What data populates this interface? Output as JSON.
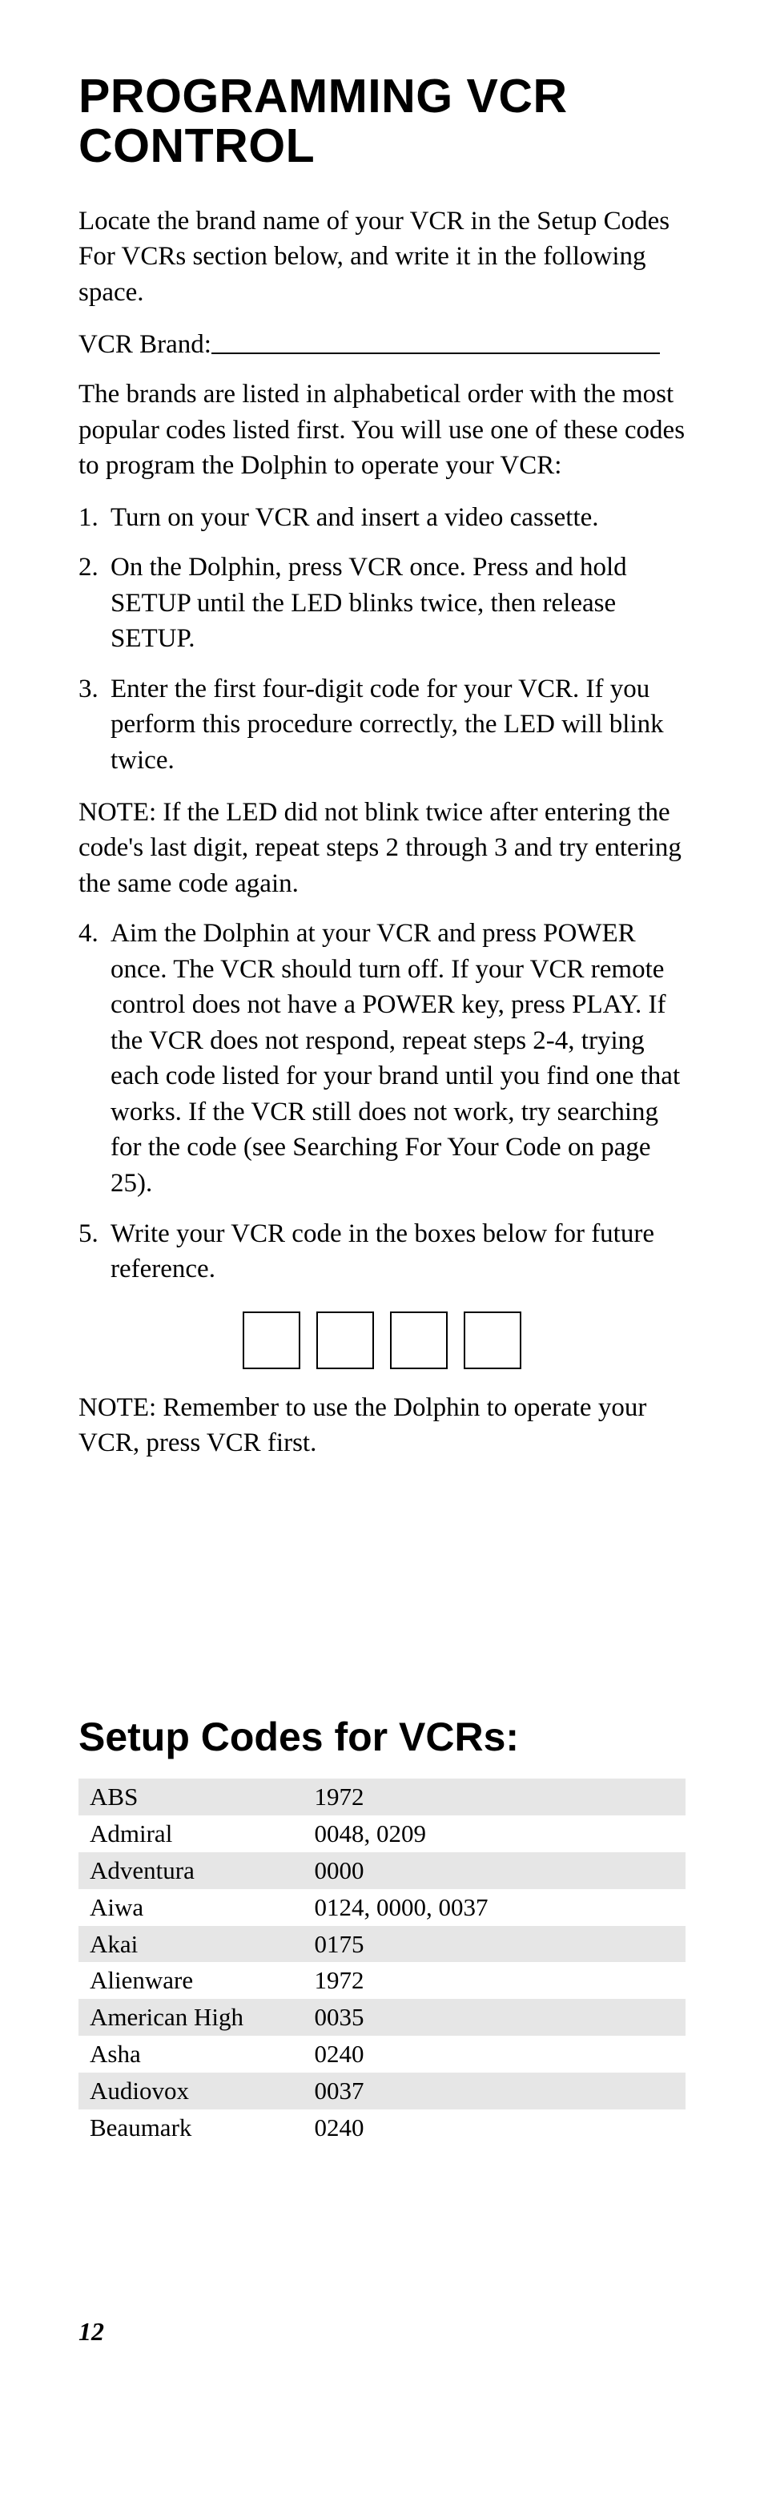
{
  "section1": {
    "title": "PROGRAMMING VCR CONTROL",
    "intro": "Locate the brand name of your VCR in the Setup Codes For VCRs section below, and write it in the following space.",
    "brand_label": "VCR Brand:",
    "brands_para": "The brands are listed in alphabetical order with the most popular codes listed first. You will use one of these codes to program the Dolphin to operate your VCR:",
    "steps_a": [
      "Turn on your VCR and insert a video cassette.",
      "On the Dolphin, press VCR once. Press and hold SETUP until the LED blinks twice, then release SETUP.",
      "Enter the first four-digit code for your VCR. If you perform this procedure correctly, the LED will blink twice."
    ],
    "note1": "NOTE: If the LED did not blink twice after entering the code's last digit, repeat steps 2 through 3 and try entering the same code again.",
    "steps_b": [
      "Aim the Dolphin at your VCR and press POWER once. The VCR should turn off. If your VCR remote control does not have a POWER key, press PLAY. If the VCR does not respond, repeat steps 2-4, trying each code listed for your brand until you find one that works. If the VCR still does not work, try searching for the code (see Searching For Your Code on page 25).",
      "Write your VCR code in the boxes below for future reference."
    ],
    "note2": "NOTE: Remember to use the Dolphin to operate your VCR, press VCR first."
  },
  "section2": {
    "title": "Setup Codes for VCRs:",
    "rows": [
      {
        "brand": "ABS",
        "codes": "1972"
      },
      {
        "brand": "Admiral",
        "codes": "0048, 0209"
      },
      {
        "brand": "Adventura",
        "codes": "0000"
      },
      {
        "brand": "Aiwa",
        "codes": "0124, 0000, 0037"
      },
      {
        "brand": "Akai",
        "codes": "0175"
      },
      {
        "brand": "Alienware",
        "codes": "1972"
      },
      {
        "brand": "American High",
        "codes": "0035"
      },
      {
        "brand": "Asha",
        "codes": "0240"
      },
      {
        "brand": "Audiovox",
        "codes": "0037"
      },
      {
        "brand": "Beaumark",
        "codes": "0240"
      }
    ]
  },
  "page_number": "12"
}
